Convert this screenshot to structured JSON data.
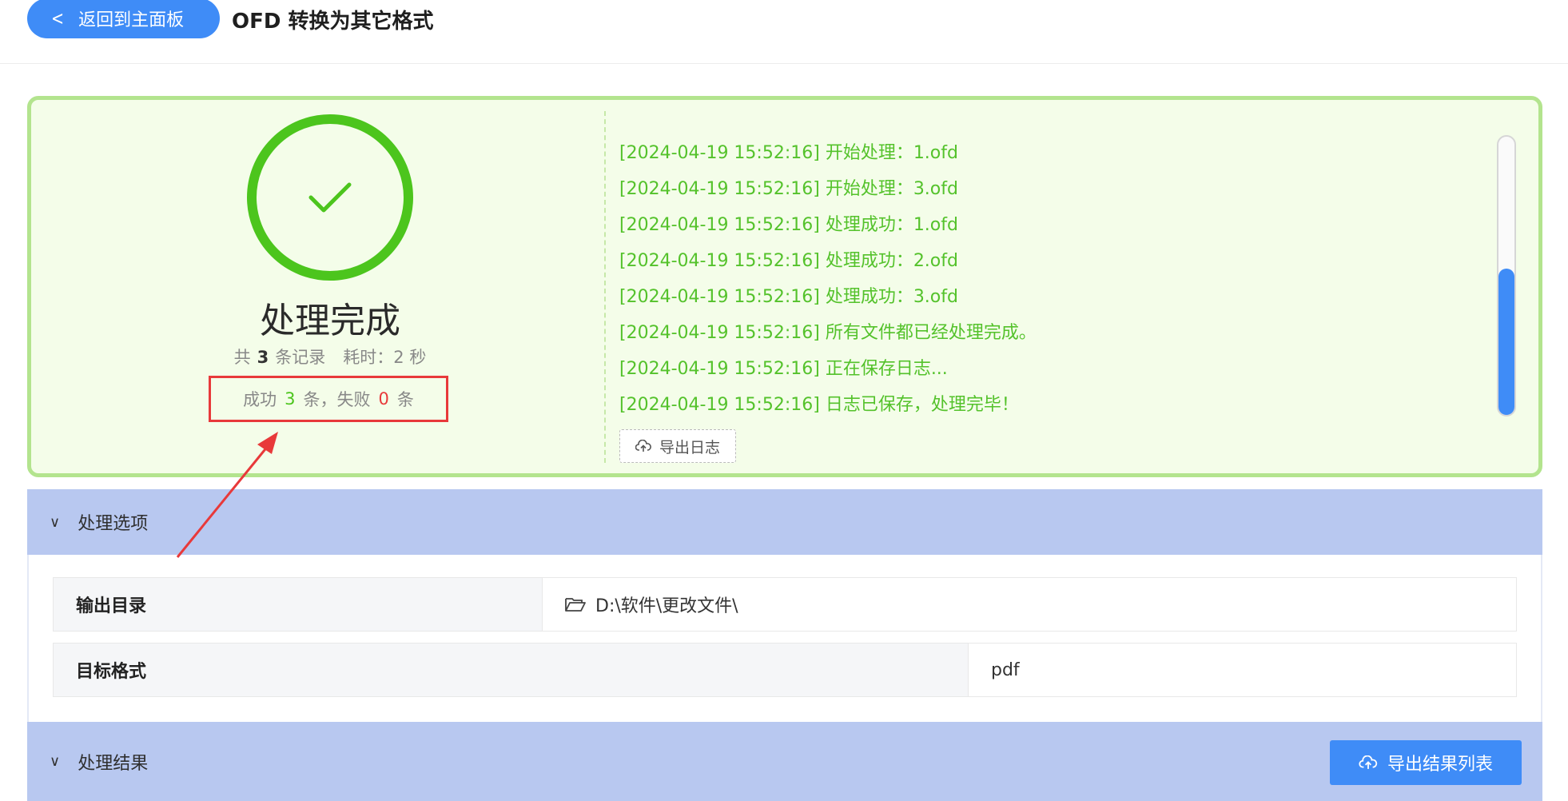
{
  "header": {
    "back_label": "返回到主面板",
    "title": "OFD 转换为其它格式"
  },
  "status": {
    "title": "处理完成",
    "summary_prefix": "共",
    "total": "3",
    "summary_unit": "条记录",
    "elapsed": "耗时：2 秒",
    "success_prefix": "成功",
    "success_count": "3",
    "success_suffix": "条，失败",
    "fail_count": "0",
    "fail_suffix": "条"
  },
  "log": {
    "lines": [
      "[2024-04-19 15:52:16] 开始处理：1.ofd",
      "[2024-04-19 15:52:16] 开始处理：3.ofd",
      "[2024-04-19 15:52:16] 处理成功：1.ofd",
      "[2024-04-19 15:52:16] 处理成功：2.ofd",
      "[2024-04-19 15:52:16] 处理成功：3.ofd",
      "[2024-04-19 15:52:16] 所有文件都已经处理完成。",
      "[2024-04-19 15:52:16] 正在保存日志...",
      "[2024-04-19 15:52:16] 日志已保存，处理完毕！"
    ],
    "export_label": "导出日志"
  },
  "options": {
    "section_title": "处理选项",
    "output_dir_label": "输出目录",
    "output_dir_value": "D:\\软件\\更改文件\\",
    "format_label": "目标格式",
    "format_value": "pdf"
  },
  "results": {
    "section_title": "处理结果",
    "export_label": "导出结果列表"
  },
  "colors": {
    "accent": "#3f8cf7",
    "success": "#4cc51d",
    "fail": "#e8393a",
    "panel_bg": "#f4fde9",
    "section_bg": "#b8c8f0"
  }
}
